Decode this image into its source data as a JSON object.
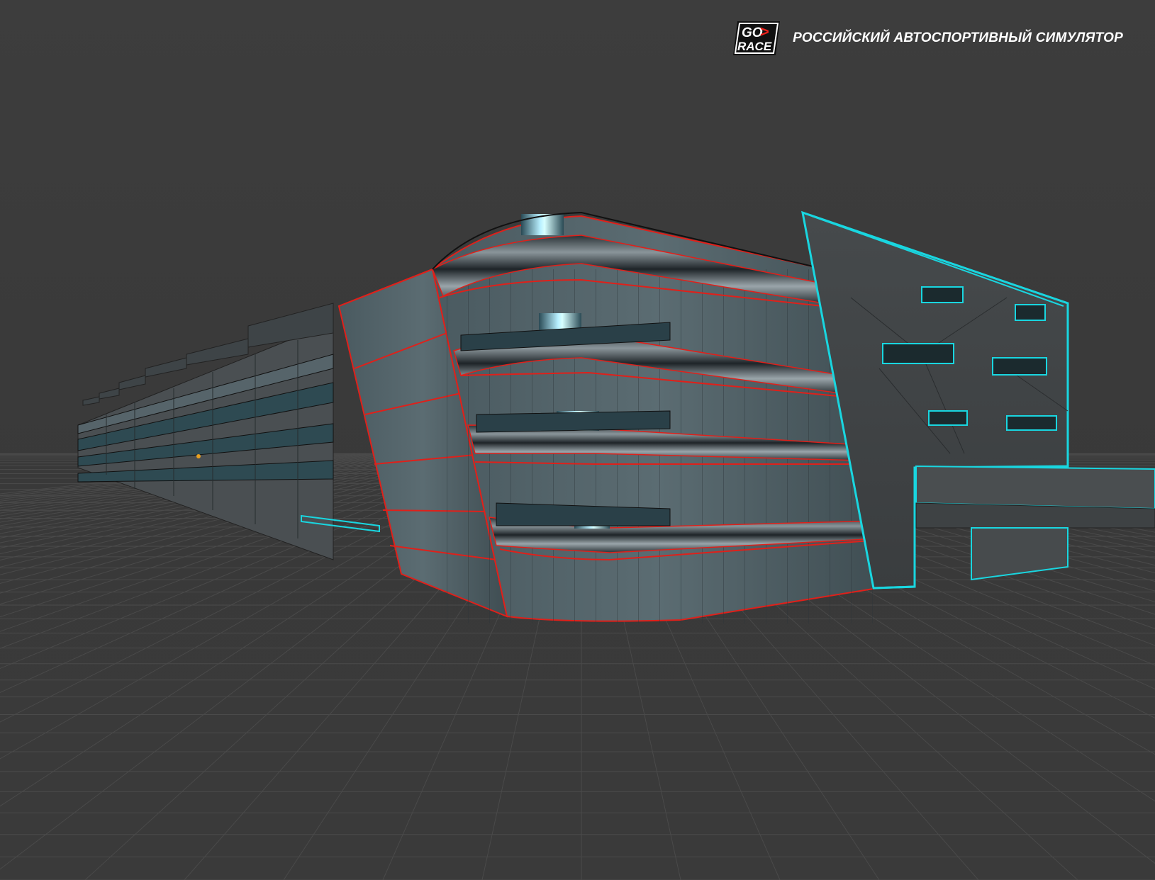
{
  "header": {
    "logo_line1": "GO",
    "logo_line2": "RACE",
    "logo_arrow": ">",
    "tagline": "РОССИЙСКИЙ АВТОСПОРТИВНЫЙ СИМУЛЯТОР"
  },
  "viewport": {
    "background_color": "#3b3b3b",
    "grid_color": "#4a4a4a",
    "selection_colors": {
      "main_building_edges": "#e0201a",
      "tower_edges": "#19d6e0"
    }
  }
}
